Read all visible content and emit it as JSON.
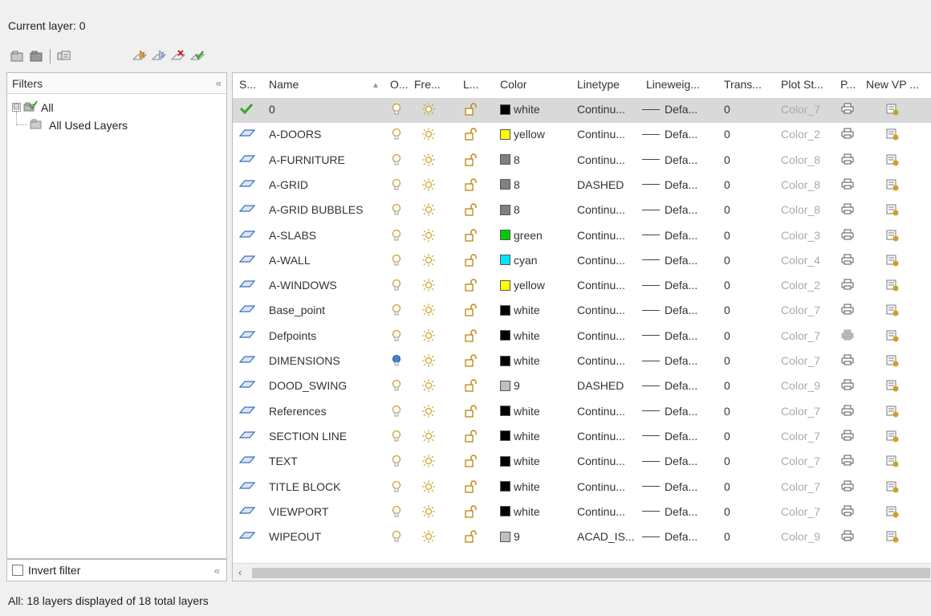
{
  "current_layer": "Current layer: 0",
  "toolbar": {
    "buttons": [
      "new-property-filter-icon",
      "new-group-filter-icon",
      "layer-states-manager-icon",
      "new-layer-icon",
      "new-layer-vp-frozen-icon",
      "delete-layer-icon",
      "set-current-icon"
    ]
  },
  "filters": {
    "title": "Filters",
    "collapse_glyph": "«",
    "tree": [
      {
        "label": "All",
        "expander": "⊟",
        "level": 0
      },
      {
        "label": "All Used Layers",
        "level": 1
      }
    ],
    "invert_filter_label": "Invert filter",
    "invert_filter_checked": false
  },
  "table": {
    "columns": [
      "S...",
      "Name",
      "O...",
      "Fre...",
      "L...",
      "Color",
      "Linetype",
      "Lineweig...",
      "Trans...",
      "Plot St...",
      "P...",
      "New VP ..."
    ],
    "sort_arrow": "▲",
    "rows": [
      {
        "status": "current",
        "name": "0",
        "color_name": "white",
        "color_hex": "#000000",
        "linetype": "Continu...",
        "lineweight": "Defa...",
        "trans": "0",
        "plot_style": "Color_7",
        "plot": "yes",
        "on_blue": false,
        "selected": true
      },
      {
        "status": "layer",
        "name": "A-DOORS",
        "color_name": "yellow",
        "color_hex": "#ffff00",
        "linetype": "Continu...",
        "lineweight": "Defa...",
        "trans": "0",
        "plot_style": "Color_2",
        "plot": "yes",
        "on_blue": false
      },
      {
        "status": "layer",
        "name": "A-FURNITURE",
        "color_name": "8",
        "color_hex": "#808080",
        "linetype": "Continu...",
        "lineweight": "Defa...",
        "trans": "0",
        "plot_style": "Color_8",
        "plot": "yes",
        "on_blue": false
      },
      {
        "status": "layer",
        "name": "A-GRID",
        "color_name": "8",
        "color_hex": "#808080",
        "linetype": "DASHED",
        "lineweight": "Defa...",
        "trans": "0",
        "plot_style": "Color_8",
        "plot": "yes",
        "on_blue": false
      },
      {
        "status": "layer",
        "name": "A-GRID BUBBLES",
        "color_name": "8",
        "color_hex": "#808080",
        "linetype": "Continu...",
        "lineweight": "Defa...",
        "trans": "0",
        "plot_style": "Color_8",
        "plot": "yes",
        "on_blue": false
      },
      {
        "status": "layer",
        "name": "A-SLABS",
        "color_name": "green",
        "color_hex": "#00cc00",
        "linetype": "Continu...",
        "lineweight": "Defa...",
        "trans": "0",
        "plot_style": "Color_3",
        "plot": "yes",
        "on_blue": false
      },
      {
        "status": "layer",
        "name": "A-WALL",
        "color_name": "cyan",
        "color_hex": "#00e5ff",
        "linetype": "Continu...",
        "lineweight": "Defa...",
        "trans": "0",
        "plot_style": "Color_4",
        "plot": "yes",
        "on_blue": false
      },
      {
        "status": "layer",
        "name": "A-WINDOWS",
        "color_name": "yellow",
        "color_hex": "#ffff00",
        "linetype": "Continu...",
        "lineweight": "Defa...",
        "trans": "0",
        "plot_style": "Color_2",
        "plot": "yes",
        "on_blue": false
      },
      {
        "status": "layer",
        "name": "Base_point",
        "color_name": "white",
        "color_hex": "#000000",
        "linetype": "Continu...",
        "lineweight": "Defa...",
        "trans": "0",
        "plot_style": "Color_7",
        "plot": "yes",
        "on_blue": false
      },
      {
        "status": "layer",
        "name": "Defpoints",
        "color_name": "white",
        "color_hex": "#000000",
        "linetype": "Continu...",
        "lineweight": "Defa...",
        "trans": "0",
        "plot_style": "Color_7",
        "plot": "no",
        "on_blue": false
      },
      {
        "status": "layer",
        "name": "DIMENSIONS",
        "color_name": "white",
        "color_hex": "#000000",
        "linetype": "Continu...",
        "lineweight": "Defa...",
        "trans": "0",
        "plot_style": "Color_7",
        "plot": "yes",
        "on_blue": true
      },
      {
        "status": "layer",
        "name": "DOOD_SWING",
        "color_name": "9",
        "color_hex": "#c0c0c0",
        "linetype": "DASHED",
        "lineweight": "Defa...",
        "trans": "0",
        "plot_style": "Color_9",
        "plot": "yes",
        "on_blue": false
      },
      {
        "status": "layer",
        "name": "References",
        "color_name": "white",
        "color_hex": "#000000",
        "linetype": "Continu...",
        "lineweight": "Defa...",
        "trans": "0",
        "plot_style": "Color_7",
        "plot": "yes",
        "on_blue": false
      },
      {
        "status": "layer",
        "name": "SECTION LINE",
        "color_name": "white",
        "color_hex": "#000000",
        "linetype": "Continu...",
        "lineweight": "Defa...",
        "trans": "0",
        "plot_style": "Color_7",
        "plot": "yes",
        "on_blue": false
      },
      {
        "status": "layer",
        "name": "TEXT",
        "color_name": "white",
        "color_hex": "#000000",
        "linetype": "Continu...",
        "lineweight": "Defa...",
        "trans": "0",
        "plot_style": "Color_7",
        "plot": "yes",
        "on_blue": false
      },
      {
        "status": "layer",
        "name": "TITLE BLOCK",
        "color_name": "white",
        "color_hex": "#000000",
        "linetype": "Continu...",
        "lineweight": "Defa...",
        "trans": "0",
        "plot_style": "Color_7",
        "plot": "yes",
        "on_blue": false
      },
      {
        "status": "layer",
        "name": "VIEWPORT",
        "color_name": "white",
        "color_hex": "#000000",
        "linetype": "Continu...",
        "lineweight": "Defa...",
        "trans": "0",
        "plot_style": "Color_7",
        "plot": "yes",
        "on_blue": false
      },
      {
        "status": "layer",
        "name": "WIPEOUT",
        "color_name": "9",
        "color_hex": "#c0c0c0",
        "linetype": "ACAD_IS...",
        "lineweight": "Defa...",
        "trans": "0",
        "plot_style": "Color_9",
        "plot": "yes",
        "on_blue": false
      }
    ]
  },
  "status_bar": "All: 18 layers displayed of 18 total layers",
  "colors": {
    "selection": "#d9d9d9",
    "current_check": "#3aa628",
    "layer_icon": "#3b6fb0",
    "bulb_yellow": "#c9a227",
    "bulb_blue": "#4a7fc8",
    "lock_gold": "#b8860b"
  }
}
